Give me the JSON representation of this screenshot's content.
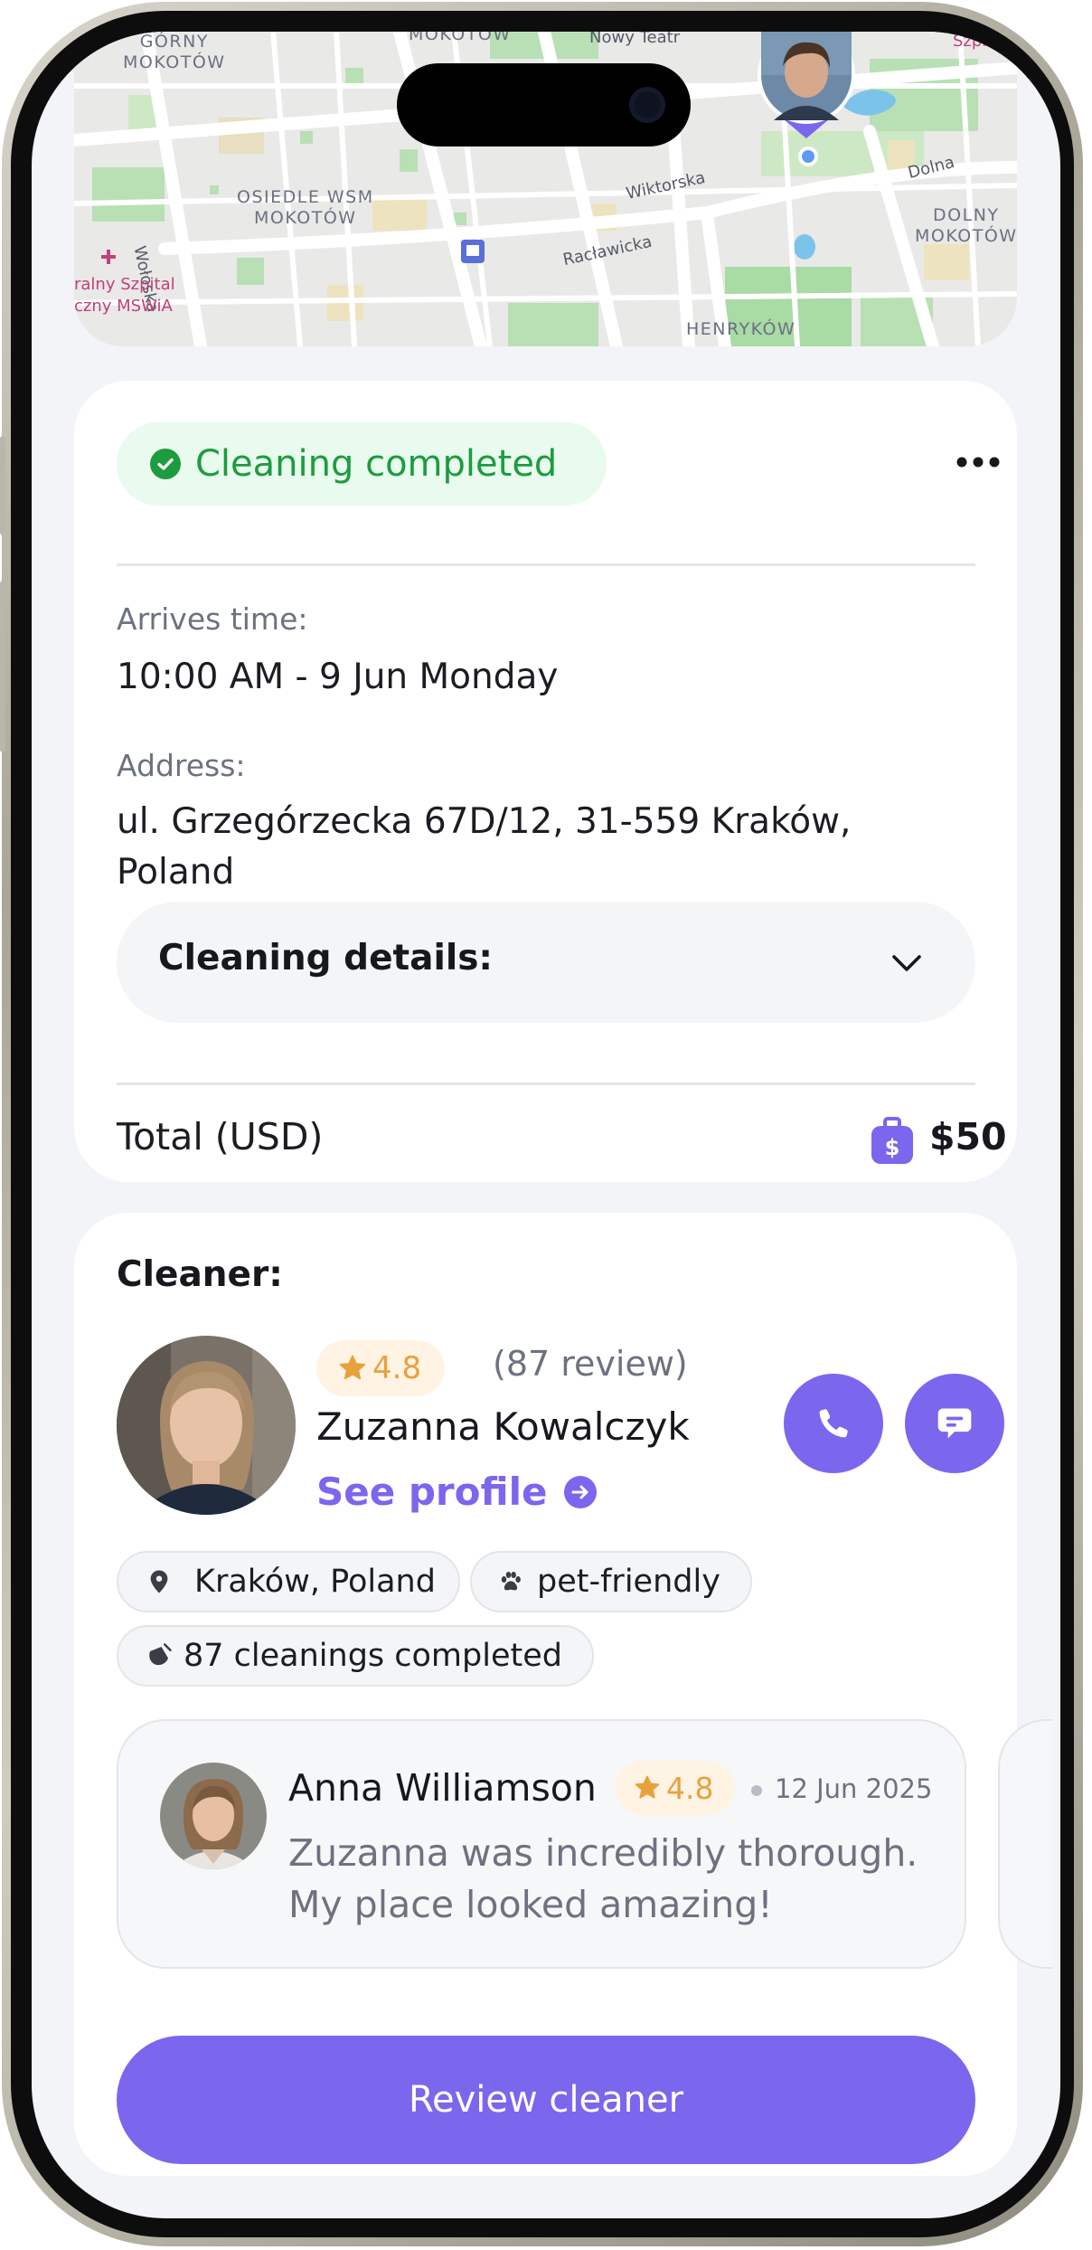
{
  "map": {
    "district_labels": [
      "GÓRNY\nMOKOTÓW",
      "OSIEDLE WSM\nMOKOTÓW",
      "DOLNY\nMOKOTÓW",
      "HENRYKÓW"
    ],
    "top_label": "MOKOTÓW",
    "streets": [
      "Nowy Teatr",
      "Wiktorska",
      "Racławicka",
      "Dolna",
      "Wołoska",
      "Szpital"
    ],
    "hospital_label": "ralny Szpital\nczny MSWiA"
  },
  "order": {
    "status": "Cleaning completed",
    "arrives_label": "Arrives time:",
    "arrives_value": "10:00 AM - 9 Jun Monday",
    "address_label": "Address:",
    "address_value": "ul. Grzegórzecka 67D/12, 31-559 Kraków, Poland",
    "details_label": "Cleaning details:",
    "total_label": "Total (USD)",
    "total_amount": "$50"
  },
  "cleaner": {
    "section_title": "Cleaner:",
    "rating": "4.8",
    "reviews": "(87 review)",
    "name": "Zuzanna Kowalczyk",
    "see_profile": "See profile",
    "chips": {
      "location": "Kraków, Poland",
      "pets": "pet-friendly",
      "cleanings": "87 cleanings completed"
    },
    "review": {
      "author": "Anna Williamson",
      "rating": "4.8",
      "date": "12 Jun 2025",
      "text": "Zuzanna was incredibly thorough. My place looked amazing!"
    },
    "review_button": "Review cleaner"
  },
  "colors": {
    "accent": "#7b66ee",
    "success": "#1d9c3f",
    "success_bg": "#e9faee",
    "star": "#e8a23c"
  }
}
